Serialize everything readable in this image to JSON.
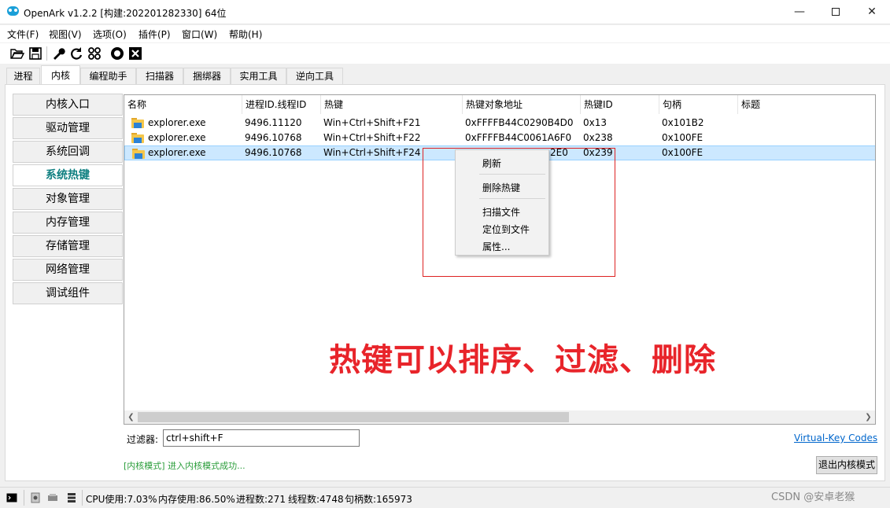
{
  "window": {
    "title": "OpenArk v1.2.2  [构建:202201282330]  64位",
    "minimize": "—",
    "close": "✕"
  },
  "menu": [
    "文件(F)",
    "视图(V)",
    "选项(O)",
    "插件(P)",
    "窗口(W)",
    "帮助(H)"
  ],
  "toolbar_icons": [
    "open-folder-icon",
    "save-icon",
    "wrench-icon",
    "refresh-icon",
    "grid-icon",
    "github-icon",
    "close-box-icon"
  ],
  "tabs": [
    "进程",
    "内核",
    "编程助手",
    "扫描器",
    "捆绑器",
    "实用工具",
    "逆向工具"
  ],
  "active_tab": "内核",
  "sidebar": [
    "内核入口",
    "驱动管理",
    "系统回调",
    "系统热键",
    "对象管理",
    "内存管理",
    "存储管理",
    "网络管理",
    "调试组件"
  ],
  "active_sidebar": "系统热键",
  "table": {
    "headers": [
      "名称",
      "进程ID.线程ID",
      "热键",
      "热键对象地址",
      "热键ID",
      "句柄",
      "标题"
    ],
    "rows": [
      [
        "explorer.exe",
        "9496.11120",
        "Win+Ctrl+Shift+F21",
        "0xFFFFB44C0290B4D0",
        "0x13",
        "0x101B2",
        ""
      ],
      [
        "explorer.exe",
        "9496.10768",
        "Win+Ctrl+Shift+F22",
        "0xFFFFB44C0061A6F0",
        "0x238",
        "0x100FE",
        ""
      ],
      [
        "explorer.exe",
        "9496.10768",
        "Win+Ctrl+Shift+F24",
        "2E0",
        "0x239",
        "0x100FE",
        ""
      ]
    ],
    "selected_row": 2
  },
  "context_menu": [
    "刷新",
    "删除热键",
    "扫描文件",
    "定位到文件",
    "属性..."
  ],
  "filter": {
    "label": "过滤器:",
    "value": "ctrl+shift+F"
  },
  "vk_link": "Virtual-Key Codes",
  "status_message": "[内核模式] 进入内核模式成功...",
  "exit_button": "退出内核模式",
  "statusbar": {
    "cpu": "CPU使用:7.03%",
    "mem": "内存使用:86.50%",
    "proc": "进程数:271",
    "threads": "线程数:4748",
    "handles": "句柄数:165973"
  },
  "annotation": "热键可以排序、过滤、删除",
  "watermark": "CSDN @安卓老猴",
  "colors": {
    "accent_teal": "#0e7f80",
    "annotation_red": "#e8242a",
    "selection": "#cce8ff",
    "status_green": "#2a9d3a"
  }
}
